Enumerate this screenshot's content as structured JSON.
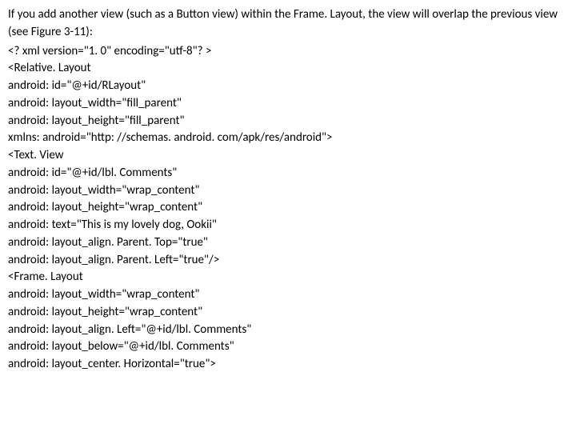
{
  "intro": "If you add another view (such as a Button view) within the Frame. Layout, the view will overlap the previous view (see Figure 3-11):",
  "code": [
    "<? xml version=\"1. 0\" encoding=\"utf-8\"? >",
    "<Relative. Layout",
    "android: id=\"@+id/RLayout\"",
    "android: layout_width=\"fill_parent\"",
    "android: layout_height=\"fill_parent\"",
    "xmlns: android=\"http: //schemas. android. com/apk/res/android\">",
    "<Text. View",
    "android: id=\"@+id/lbl. Comments\"",
    "android: layout_width=\"wrap_content\"",
    "android: layout_height=\"wrap_content\"",
    "android: text=\"This is my lovely dog, Ookii\"",
    "android: layout_align. Parent. Top=\"true\"",
    "android: layout_align. Parent. Left=\"true\"/>",
    "<Frame. Layout",
    "android: layout_width=\"wrap_content\"",
    "android: layout_height=\"wrap_content\"",
    "android: layout_align. Left=\"@+id/lbl. Comments\"",
    "android: layout_below=\"@+id/lbl. Comments\"",
    "android: layout_center. Horizontal=\"true\">"
  ]
}
